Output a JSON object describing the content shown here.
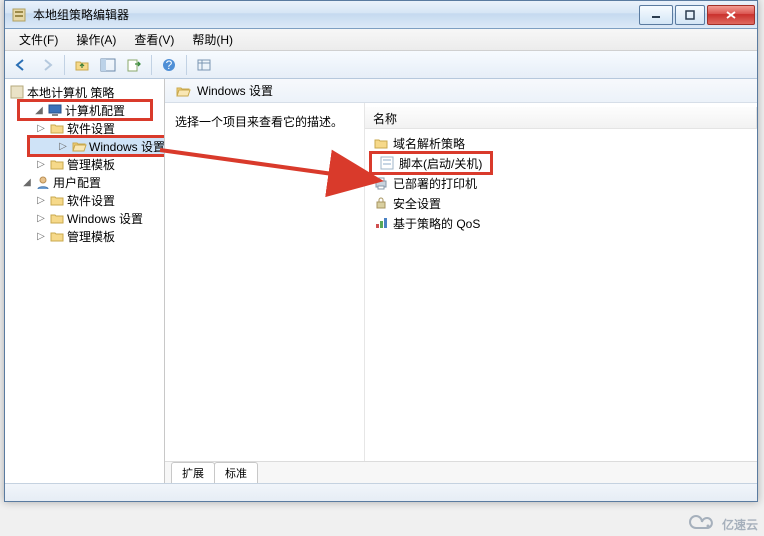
{
  "window": {
    "title": "本地组策略编辑器"
  },
  "menu": {
    "file": "文件(F)",
    "action": "操作(A)",
    "view": "查看(V)",
    "help": "帮助(H)"
  },
  "tree": {
    "root": "本地计算机 策略",
    "computer_config": "计算机配置",
    "user_config": "用户配置",
    "software_settings": "软件设置",
    "windows_settings": "Windows 设置",
    "admin_templates": "管理模板"
  },
  "right": {
    "header": "Windows 设置",
    "desc": "选择一个项目来查看它的描述。",
    "col_name": "名称",
    "items": [
      "域名解析策略",
      "脚本(启动/关机)",
      "已部署的打印机",
      "安全设置",
      "基于策略的 QoS"
    ]
  },
  "tabs": {
    "extended": "扩展",
    "standard": "标准"
  },
  "watermark": "亿速云"
}
